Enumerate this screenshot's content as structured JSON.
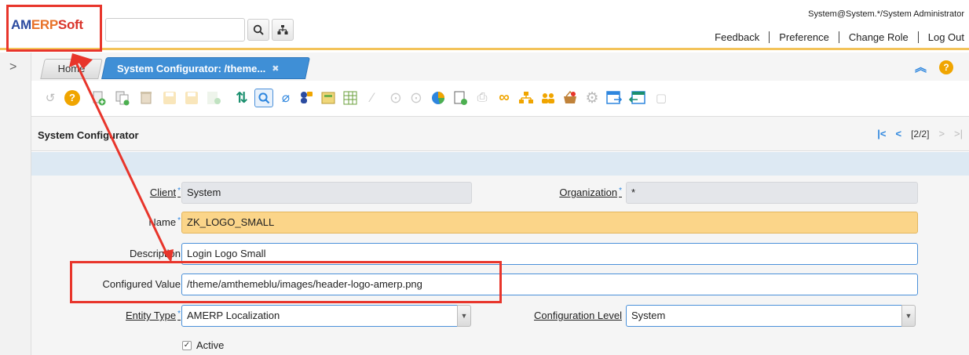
{
  "header": {
    "logo_am": "AM",
    "logo_erp": "ERP",
    "logo_soft": "Soft",
    "search_value": "",
    "user_info": "System@System.*/System Administrator",
    "links": [
      "Feedback",
      "Preference",
      "Change Role",
      "Log Out"
    ]
  },
  "tabs": {
    "home": "Home",
    "active": "System Configurator: /theme...",
    "close_glyph": "✖"
  },
  "window": {
    "title": "System Configurator",
    "record": "[2/2]"
  },
  "form": {
    "client_label": "Client",
    "client_value": "System",
    "org_label": "Organization",
    "org_value": "*",
    "name_label": "Name",
    "name_value": "ZK_LOGO_SMALL",
    "desc_label": "Description",
    "desc_value": "Login Logo Small",
    "cfg_label": "Configured Value",
    "cfg_value": "/theme/amthemeblu/images/header-logo-amerp.png",
    "entity_label": "Entity Type",
    "entity_value": "AMERP Localization",
    "level_label": "Configuration Level",
    "level_value": "System",
    "active_label": "Active",
    "required_mark": "*"
  },
  "colors": {
    "accent": "#3f8fd6",
    "mandatory": "#fbd589",
    "annotation": "#e8352b",
    "header_rule": "#f3c35a"
  }
}
